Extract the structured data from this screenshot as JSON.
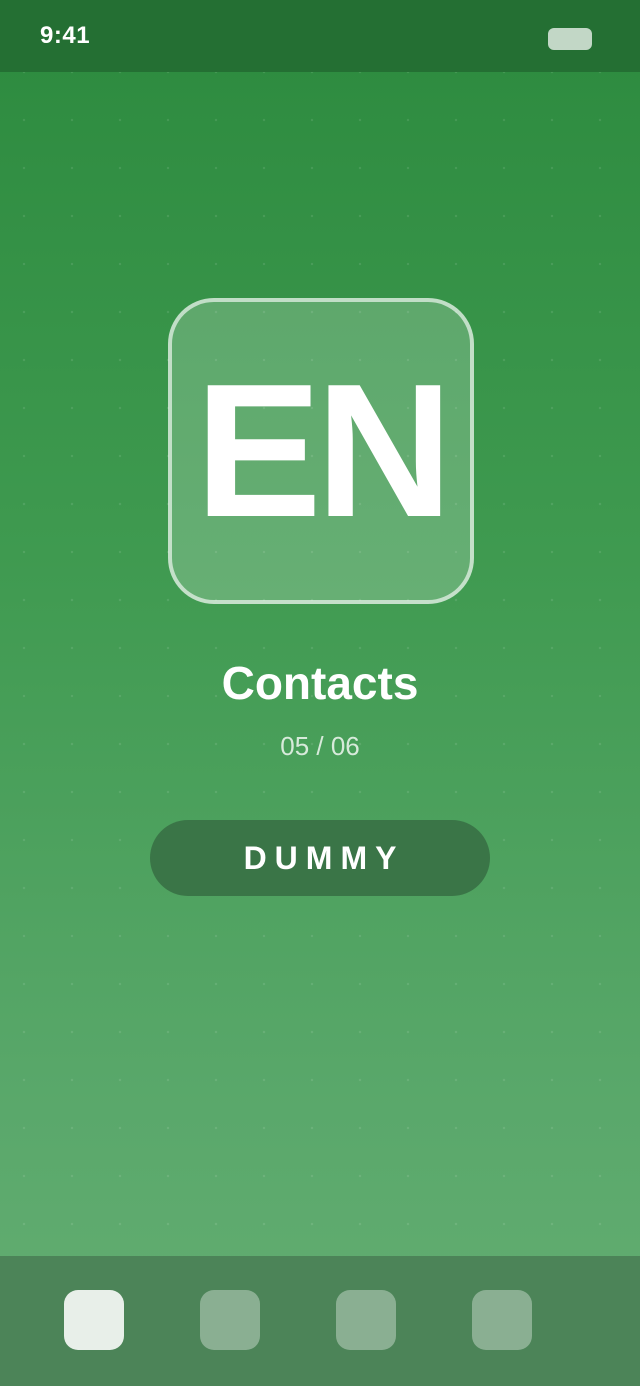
{
  "status_bar": {
    "time": "9:41"
  },
  "logo": {
    "text": "EN"
  },
  "main": {
    "title": "Contacts",
    "progress": "05 / 06",
    "action_label": "DUMMY"
  },
  "dock": {
    "items": [
      {
        "icon": "app-icon",
        "active": true
      },
      {
        "icon": "app-icon",
        "active": false
      },
      {
        "icon": "app-icon",
        "active": false
      },
      {
        "icon": "app-icon",
        "active": false
      }
    ]
  },
  "colors": {
    "background_top": "#2c8a3e",
    "background_bottom": "#64ae72",
    "status_bar": "#246f33",
    "button": "#3a7547",
    "dock": "#4c8458"
  }
}
